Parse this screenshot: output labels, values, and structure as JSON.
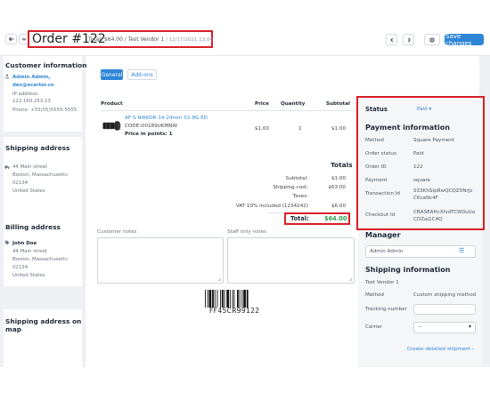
{
  "toolbar": {
    "back_icon": "arrow-left-icon",
    "dropdown_icon": "chevron-down-icon",
    "order_title": "Order #122",
    "order_summary": "Total: $64.00 / Test Vendor 1",
    "order_date": " / 12/17/2021,13:04",
    "prev_icon": "chevron-left-icon",
    "next_icon": "chevron-right-icon",
    "settings_icon": "gear-icon",
    "save_label": "Save changes"
  },
  "customer": {
    "heading": "Customer information",
    "name": "Admin Admin,",
    "email": "dev@ecarter.co",
    "ip_label": "IP address:",
    "ip": "122.160.253.13",
    "phone": "Phone: +55(55)5555-5555"
  },
  "shipping_address": {
    "heading": "Shipping address",
    "line1": "44 Main street",
    "line2": "Boston, Massachusetts",
    "line3": "02134",
    "line4": "United States"
  },
  "billing_address": {
    "heading": "Billing address",
    "name": "John Doe",
    "line1": "44 Main street",
    "line2": "Boston, Massachusetts",
    "line3": "02134",
    "line4": "United States"
  },
  "map": {
    "heading_line1": "Shipping address on",
    "heading_line2": "map"
  },
  "tabs": [
    {
      "label": "General"
    },
    {
      "label": "Add-ons"
    }
  ],
  "products": {
    "headers": {
      "product": "Product",
      "price": "Price",
      "quantity": "Quantity",
      "subtotal": "Subtotal"
    },
    "rows": [
      {
        "name": "AF-S NIKKOR 14-24mm f/2.8G ED",
        "code": "CODE:O0189UKMNW",
        "points": "Price in points: 1",
        "price": "$1.00",
        "quantity": "1",
        "subtotal": "$1.00"
      }
    ]
  },
  "totals": {
    "heading": "Totals",
    "rows": [
      {
        "label": "Subtotal:",
        "value": "$1.00"
      },
      {
        "label": "Shipping cost:",
        "value": "$63.00"
      },
      {
        "label": "Taxes:",
        "value": ""
      },
      {
        "label": "VAT 10% included (1234242)",
        "value": "$6.00"
      }
    ],
    "total_label": "Total:",
    "total_value": "$64.00"
  },
  "notes": {
    "customer_label": "Customer notes",
    "staff_label": "Staff only notes"
  },
  "barcode": {
    "value": "FF45CR99122"
  },
  "status_panel": {
    "status_label": "Status",
    "status_value": "Paid",
    "payment_heading": "Payment information",
    "rows": [
      {
        "label": "Method",
        "value": "Square Payment"
      },
      {
        "label": "Order status",
        "value": "Paid"
      },
      {
        "label": "Order ID",
        "value": "122"
      },
      {
        "label": "Payment",
        "value": "square"
      },
      {
        "label": "Transaction Id",
        "value_line1": "S33KhSIpRwQCQZ5NrJz",
        "value_line2": "C6caNc4F"
      },
      {
        "label": "Checkout Id",
        "value_line1": "CBASEAHcXfsdTCW0uUa",
        "value_line2": "CDZaJ1C4Q"
      }
    ],
    "manager_heading": "Manager",
    "manager_value": "Admin Admin",
    "shipping_heading": "Shipping information",
    "vendor": "Test Vendor 1",
    "method_label": "Method",
    "method_value": "Custom shipping method",
    "tracking_label": "Tracking number",
    "carrier_label": "Carrier",
    "carrier_value": "--",
    "create_shipment": "Create detailed shipment ›"
  },
  "colors": {
    "accent": "#2f86d6",
    "highlight": "#d81f26",
    "total_green": "#2e9e4f"
  }
}
